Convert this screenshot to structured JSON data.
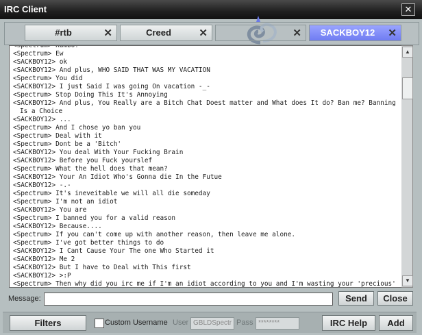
{
  "window": {
    "title": "IRC Client",
    "close_glyph": "✕"
  },
  "tabs": [
    {
      "label": "#rtb",
      "close": "✕"
    },
    {
      "label": "Creed",
      "close": "✕"
    },
    {
      "label": "",
      "close": "✕"
    },
    {
      "label": "SACKBOY12",
      "close": "✕",
      "active": true
    }
  ],
  "chat": {
    "lines": [
      "<Spectrum> Kumbo?",
      "<Spectrum> Ew",
      "<SACKBOY12> ok",
      "<SACKBOY12> And plus, WHO SAID THAT WAS MY VACATION",
      "<Spectrum> You did",
      "<SACKBOY12> I just Said I was going On vacation -_-",
      "<Spectrum> Stop Doing This It's Annoying",
      "<SACKBOY12> And plus, You Really are a Bitch Chat Doest matter and What does It do? Ban me? Banning Is a Choice",
      "<SACKBOY12> ...",
      "<Spectrum> And I chose yo ban you",
      "<Spectrum> Deal with it",
      "<Spectrum> Dont be a 'Bitch'",
      "<SACKBOY12> You deal With Your Fucking Brain",
      "<SACKBOY12> Before you Fuck yourslef",
      "<Spectrum> What the hell does that mean?",
      "<SACKBOY12> Your An Idiot Who's Gonna die In the Futue",
      "<SACKBOY12> -.-",
      "<Spectrum> It's ineveitable we will all die someday",
      "<Spectrum> I'm not an idiot",
      "<SACKBOY12> You are",
      "<Spectrum> I banned you for a valid reason",
      "<SACKBOY12> Because....",
      "<Spectrum> If you can't come up with another reason, then leave me alone.",
      "<Spectrum> I've got better things to do",
      "<SACKBOY12> I Cant Cause Your The one Who Started it",
      "<SACKBOY12> Me 2",
      "<SACKBOY12> But I have to Deal with This first",
      "<SACKBOY12> >:P",
      "<Spectrum> Then why did you irc me if I'm an idiot according to you and I'm wasting your 'precious' time?"
    ]
  },
  "scrollbar": {
    "up_glyph": "▲",
    "down_glyph": "▼"
  },
  "message": {
    "label": "Message:",
    "value": ""
  },
  "buttons": {
    "send": "Send",
    "close": "Close",
    "filters": "Filters",
    "irc_help": "IRC Help",
    "add": "Add"
  },
  "options": {
    "custom_username_label": "Custom Username",
    "user_label": "User",
    "user_value": "GBLDSpectr",
    "pass_label": "Pass",
    "pass_value": "********"
  }
}
